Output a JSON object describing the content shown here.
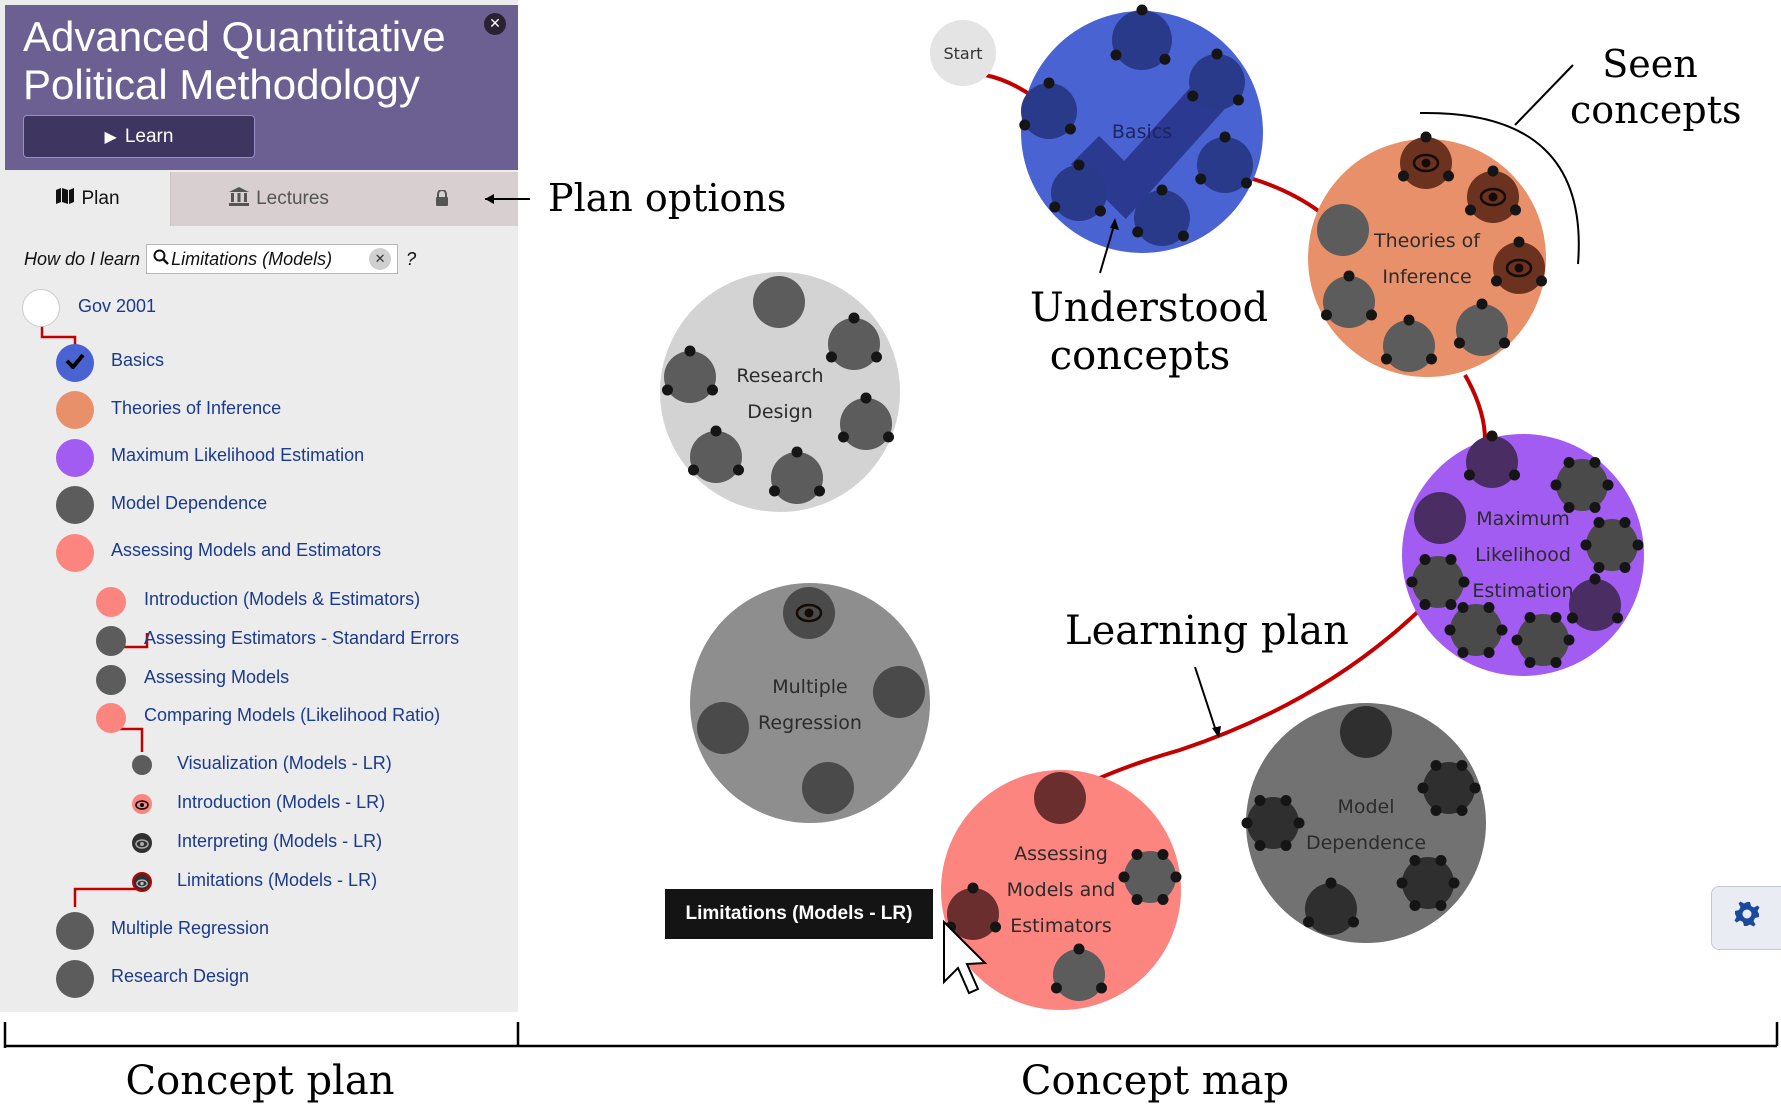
{
  "app": {
    "title": "Advanced Quantitative Political Methodology",
    "learn_label": "Learn",
    "close_icon": "close-icon"
  },
  "tabs": [
    {
      "label": "Plan",
      "icon": "map-icon",
      "active": true
    },
    {
      "label": "Lectures",
      "icon": "institution-icon",
      "active": false
    }
  ],
  "search": {
    "label": "How do I learn",
    "value": "Limitations (Models)",
    "help": "?"
  },
  "plan": {
    "root": "Gov 2001",
    "items": [
      {
        "label": "Basics",
        "color": "#4a63d3",
        "state": "understood"
      },
      {
        "label": "Theories of Inference",
        "color": "#e8906a"
      },
      {
        "label": "Maximum Likelihood Estimation",
        "color": "#a35cf2"
      },
      {
        "label": "Model Dependence",
        "color": "#5c5c5c"
      },
      {
        "label": "Assessing Models and Estimators",
        "color": "#fc8580"
      },
      {
        "label": "Introduction (Models & Estimators)",
        "color": "#fc8580"
      },
      {
        "label": "Assessing Estimators - Standard Errors",
        "color": "#5c5c5c"
      },
      {
        "label": "Assessing Models",
        "color": "#5c5c5c"
      },
      {
        "label": "Comparing Models (Likelihood Ratio)",
        "color": "#fc8580"
      },
      {
        "label": "Visualization (Models - LR)",
        "color": "#5c5c5c"
      },
      {
        "label": "Introduction (Models - LR)",
        "color": "#fc8580",
        "state": "seen"
      },
      {
        "label": "Interpreting (Models - LR)",
        "color": "#303030",
        "state": "seen"
      },
      {
        "label": "Limitations (Models - LR)",
        "color": "#303030",
        "state": "seen"
      },
      {
        "label": "Multiple Regression",
        "color": "#5c5c5c"
      },
      {
        "label": "Research Design",
        "color": "#5c5c5c"
      }
    ]
  },
  "map": {
    "start_label": "Start",
    "concepts": {
      "basics": "Basics",
      "theories": [
        "Theories of",
        "Inference"
      ],
      "mle": [
        "Maximum",
        "Likelihood",
        "Estimation"
      ],
      "assessing": [
        "Assessing",
        "Models and",
        "Estimators"
      ],
      "model_dependence": [
        "Model",
        "Dependence"
      ],
      "multiple_regression": [
        "Multiple",
        "Regression"
      ],
      "research_design": [
        "Research",
        "Design"
      ]
    },
    "colors": {
      "basics": "#4a63d3",
      "theories": "#e8906a",
      "mle": "#a35cf2",
      "assessing": "#fc8580",
      "model_dependence": "#727272",
      "multiple_regression": "#8e8e8e",
      "research_design": "#d3d3d3",
      "path": "#c30000"
    },
    "tooltip": "Limitations (Models - LR)",
    "settings_icon": "gear-icon"
  },
  "annotations": {
    "plan_options": "Plan options",
    "seen_concepts": [
      "Seen",
      "concepts"
    ],
    "understood_concepts": [
      "Understood",
      "concepts"
    ],
    "learning_plan": "Learning plan",
    "concept_plan": "Concept plan",
    "concept_map": "Concept map"
  }
}
